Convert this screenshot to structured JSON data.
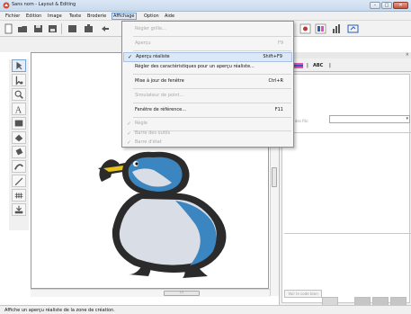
{
  "window": {
    "title": "Sans nom - Layout & Editing",
    "controls": [
      "minimize",
      "maximize",
      "close"
    ]
  },
  "menubar": {
    "items": [
      "Fichier",
      "Edition",
      "Image",
      "Texte",
      "Broderie",
      "Affichage",
      "Option",
      "Aide"
    ],
    "active": "Affichage"
  },
  "dropdown": {
    "items": [
      {
        "label": "Régler grille...",
        "shortcut": "",
        "checked": false,
        "enabled": false
      },
      {
        "label": "Aperçu",
        "shortcut": "F9",
        "checked": false,
        "enabled": false
      },
      {
        "label": "Aperçu réaliste",
        "shortcut": "Shift+F9",
        "checked": true,
        "enabled": true
      },
      {
        "label": "Régler des caractéristiques pour un aperçu réaliste...",
        "shortcut": "",
        "checked": false,
        "enabled": true
      },
      {
        "label": "Mise à jour de fenêtre",
        "shortcut": "Ctrl+R",
        "checked": false,
        "enabled": true
      },
      {
        "label": "Simulateur de point...",
        "shortcut": "",
        "checked": false,
        "enabled": false
      },
      {
        "label": "Fenêtre de référence...",
        "shortcut": "F11",
        "checked": false,
        "enabled": true
      },
      {
        "label": "Règle",
        "shortcut": "",
        "checked": true,
        "enabled": false
      },
      {
        "label": "Barre des outils",
        "shortcut": "",
        "checked": true,
        "enabled": false
      },
      {
        "label": "Barre d'état",
        "shortcut": "",
        "checked": true,
        "enabled": false
      }
    ]
  },
  "right_panel": {
    "tab_label": "ABC",
    "thread_label": "Nbre des fils:",
    "see_button": "Voir le code bien"
  },
  "canvas": {
    "design": "penguin-embroidery"
  },
  "status": {
    "text": "Affiche un aperçu réaliste de la zone de création."
  },
  "colors": {
    "penguin_dark": "#2b2b2b",
    "penguin_blue": "#3b86c0",
    "penguin_light": "#d8dde6",
    "beak": "#e6c21a",
    "accent": "#7aa0d0"
  }
}
